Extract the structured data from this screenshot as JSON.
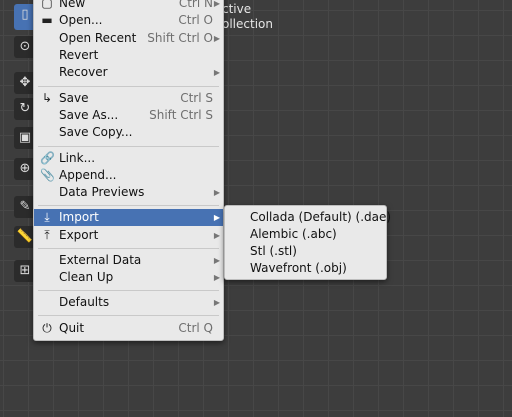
{
  "viewport": {
    "overlay_line1": "ctive",
    "overlay_line2": "ollection"
  },
  "toolbar": {
    "tools": [
      {
        "icon": "select-box-icon",
        "glyph": "▯"
      },
      {
        "icon": "cursor-icon",
        "glyph": "⊙"
      },
      {
        "icon": "move-icon",
        "glyph": "✥"
      },
      {
        "icon": "rotate-icon",
        "glyph": "↻"
      },
      {
        "icon": "scale-icon",
        "glyph": "▣"
      },
      {
        "icon": "transform-icon",
        "glyph": "⊕"
      },
      {
        "icon": "annotate-icon",
        "glyph": "✎"
      },
      {
        "icon": "measure-icon",
        "glyph": "📏"
      },
      {
        "icon": "add-cube-icon",
        "glyph": "⊞"
      }
    ]
  },
  "file_menu": {
    "items": [
      {
        "label": "New",
        "shortcut": "Ctrl N",
        "icon": "new-file-icon",
        "glyph": "▢",
        "submenu": true
      },
      {
        "label": "Open...",
        "shortcut": "Ctrl O",
        "icon": "folder-icon",
        "glyph": "▬",
        "submenu": false
      },
      {
        "label": "Open Recent",
        "shortcut": "Shift Ctrl O",
        "icon": "",
        "glyph": "",
        "submenu": true
      },
      {
        "label": "Revert",
        "shortcut": "",
        "icon": "",
        "glyph": "",
        "submenu": false
      },
      {
        "label": "Recover",
        "shortcut": "",
        "icon": "",
        "glyph": "",
        "submenu": true
      },
      {
        "label": "Save",
        "shortcut": "Ctrl S",
        "icon": "save-icon",
        "glyph": "↳",
        "submenu": false
      },
      {
        "label": "Save As...",
        "shortcut": "Shift Ctrl S",
        "icon": "",
        "glyph": "",
        "submenu": false
      },
      {
        "label": "Save Copy...",
        "shortcut": "",
        "icon": "",
        "glyph": "",
        "submenu": false
      },
      {
        "label": "Link...",
        "shortcut": "",
        "icon": "link-icon",
        "glyph": "🔗",
        "submenu": false
      },
      {
        "label": "Append...",
        "shortcut": "",
        "icon": "paperclip-icon",
        "glyph": "📎",
        "submenu": false
      },
      {
        "label": "Data Previews",
        "shortcut": "",
        "icon": "",
        "glyph": "",
        "submenu": true
      },
      {
        "label": "Import",
        "shortcut": "",
        "icon": "import-icon",
        "glyph": "⤓",
        "submenu": true
      },
      {
        "label": "Export",
        "shortcut": "",
        "icon": "export-icon",
        "glyph": "⤒",
        "submenu": true
      },
      {
        "label": "External Data",
        "shortcut": "",
        "icon": "",
        "glyph": "",
        "submenu": true
      },
      {
        "label": "Clean Up",
        "shortcut": "",
        "icon": "",
        "glyph": "",
        "submenu": true
      },
      {
        "label": "Defaults",
        "shortcut": "",
        "icon": "",
        "glyph": "",
        "submenu": true
      },
      {
        "label": "Quit",
        "shortcut": "Ctrl Q",
        "icon": "power-icon",
        "glyph": "⏻",
        "submenu": false
      }
    ]
  },
  "import_submenu": {
    "items": [
      {
        "label": "Collada (Default) (.dae)"
      },
      {
        "label": "Alembic (.abc)"
      },
      {
        "label": "Stl (.stl)"
      },
      {
        "label": "Wavefront (.obj)"
      }
    ]
  }
}
